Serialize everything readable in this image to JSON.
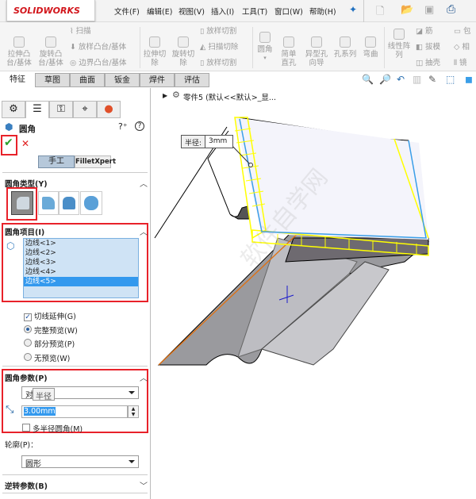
{
  "app": {
    "logo": "SOLIDWORKS"
  },
  "menu": [
    "文件(F)",
    "编辑(E)",
    "视图(V)",
    "插入(I)",
    "工具(T)",
    "窗口(W)",
    "帮助(H)"
  ],
  "toolbar": {
    "extrude_boss": "拉伸凸台/基体",
    "revolve_boss": "旋转凸台/基体",
    "sweep": "扫描",
    "loft_boss": "放样凸台/基体",
    "boundary_boss": "边界凸台/基体",
    "extrude_cut": "拉伸切除",
    "revolve_cut": "旋转切除",
    "loft_cut": "放样切割",
    "sweep_cut": "扫描切除",
    "boundary_cut": "放样切割",
    "fillet": "圆角",
    "simple_hole": "简单直孔",
    "hole_wizard": "异型孔向导",
    "hole_series": "孔系列",
    "flex": "弯曲",
    "linear_pattern": "线性阵列",
    "rib": "筋",
    "draft": "拔模",
    "shell": "抽壳",
    "wrap": "包",
    "intersect": "相",
    "mirror": "镜"
  },
  "tabs": [
    "特征",
    "草图",
    "曲面",
    "钣金",
    "焊件",
    "评估"
  ],
  "tree": {
    "part": "零件5  (默认<<默认>_显..."
  },
  "panel": {
    "title": "圆角",
    "manual": "手工",
    "fillet_xpert": "FilletXpert",
    "fillet_type": "圆角类型(Y)",
    "fillet_items": "圆角项目(I)",
    "edges": [
      "边线<1>",
      "边线<2>",
      "边线<3>",
      "边线<4>",
      "边线<5>"
    ],
    "selected_edge": 4,
    "tangent_propagation": "切线延伸(G)",
    "preview": [
      "完整预览(W)",
      "部分预览(P)",
      "无预览(W)"
    ],
    "preview_selected": 0,
    "fillet_params": "圆角参数(P)",
    "method": "对称",
    "tooltip": "半径",
    "radius": "3.00mm",
    "multi_radius": "多半径圆角(M)",
    "profile_label": "轮廓(P)：",
    "profile": "圆形",
    "setback": "逆转参数(B)"
  },
  "callout": {
    "label": "半径:",
    "value": "3mm"
  },
  "watermark": "软件自学网",
  "colors": {
    "selection_yellow": "#ffff00",
    "edge_blue": "#3a9ee8",
    "highlight_red": "#e8222a"
  }
}
